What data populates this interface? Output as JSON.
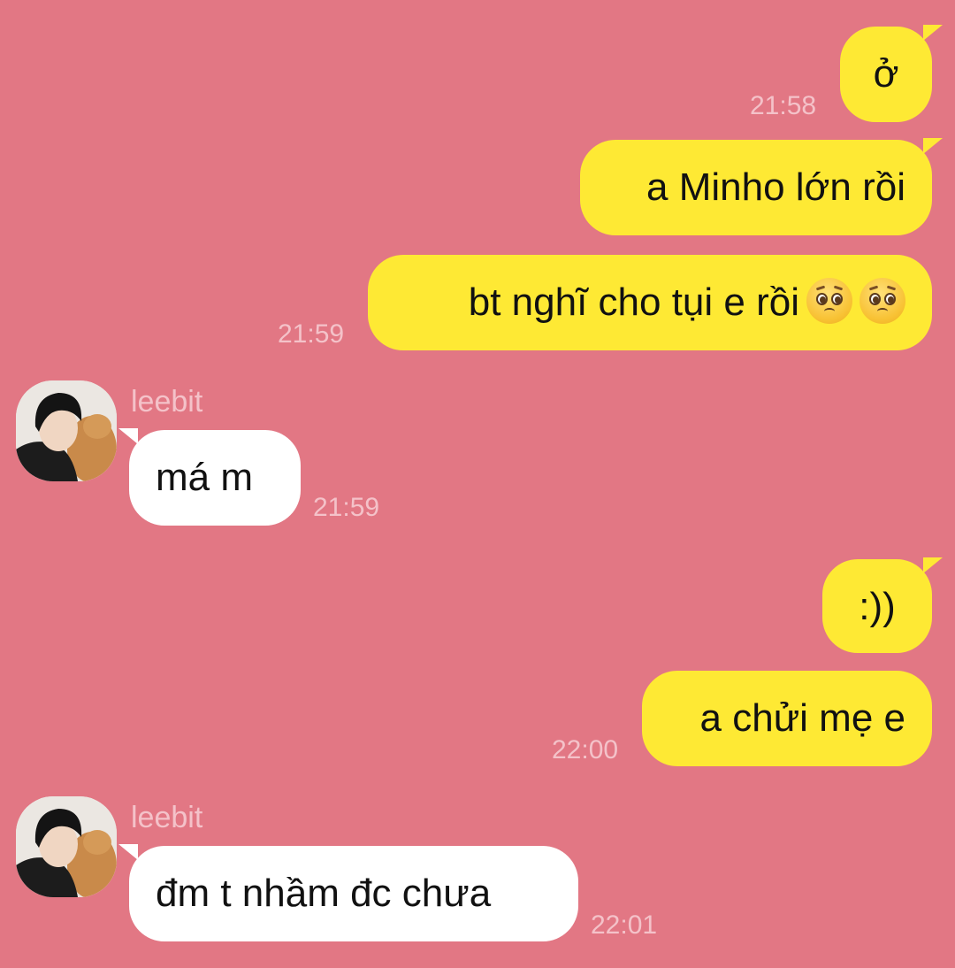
{
  "theme": {
    "background": "#e27784",
    "outgoing_bubble": "#fee934",
    "incoming_bubble": "#ffffff",
    "timestamp_color": "#f4c2c9"
  },
  "messages": [
    {
      "direction": "outgoing",
      "text": "ở",
      "time": "21:58"
    },
    {
      "direction": "outgoing",
      "text": "a Minho lớn rồi"
    },
    {
      "direction": "outgoing",
      "text": "bt nghĩ cho tụi e rồi",
      "emojis": [
        "pleading-face-emoji",
        "pleading-face-emoji"
      ],
      "time": "21:59"
    },
    {
      "direction": "incoming",
      "sender": "leebit",
      "avatar": "avatar-photo",
      "text": "má m",
      "time": "21:59"
    },
    {
      "direction": "outgoing",
      "text": ":))"
    },
    {
      "direction": "outgoing",
      "text": "a chửi mẹ e",
      "time": "22:00"
    },
    {
      "direction": "incoming",
      "sender": "leebit",
      "avatar": "avatar-photo",
      "text": "đm t nhầm đc chưa",
      "time": "22:01"
    }
  ]
}
